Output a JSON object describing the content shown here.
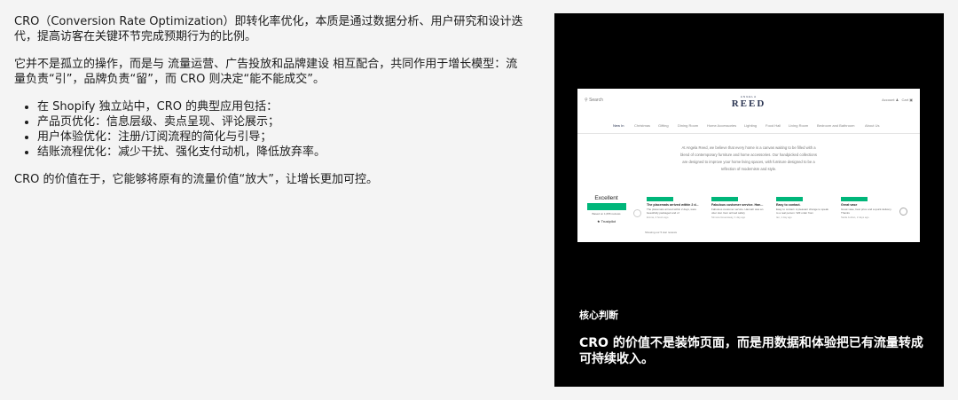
{
  "left": {
    "p1": "CRO（Conversion Rate Optimization）即转化率优化，本质是通过数据分析、用户研究和设计迭代，提高访客在关键环节完成预期行为的比例。",
    "p2": "它并不是孤立的操作，而是与 流量运营、广告投放和品牌建设 相互配合，共同作用于增长模型：流量负责“引”，品牌负责“留”，而 CRO 则决定“能不能成交”。",
    "bullets": [
      "在 Shopify 独立站中，CRO 的典型应用包括：",
      "产品页优化：信息层级、卖点呈现、评论展示；",
      "用户体验优化：注册/订阅流程的简化与引导；",
      "结账流程优化：减少干扰、强化支付动机，降低放弃率。"
    ],
    "p3": "CRO 的价值在于，它能够将原有的流量价值“放大”，让增长更加可控。"
  },
  "panel": {
    "label": "核心判断",
    "message": "CRO 的价值不是装饰页面，而是用数据和体验把已有流量转成可持续收入。"
  },
  "site": {
    "search": "Search",
    "logo_small": "ANGELA",
    "logo": "REED",
    "account": "Account",
    "cart": "Cart",
    "nav": [
      "New In",
      "Christmas",
      "Gifting",
      "Dining Room",
      "Home Accessories",
      "Lighting",
      "Food Hall",
      "Living Room",
      "Bedroom and Bathroom",
      "About Us"
    ],
    "about_lines": [
      "At Angela Reed, we believe that every home is a canvas waiting to be filled with a",
      "blend of contemporary furniture and home accessories. Our handpicked collections",
      "are designed to improve your home living spaces, with furniture designed to be a",
      "reflection of modernism and style."
    ],
    "trustpilot": {
      "rating": "Excellent",
      "based": "Based on 1,055 reviews",
      "brand": "Trustpilot"
    },
    "reviews": [
      {
        "title": "The placemats arrived within 2 d...",
        "body": "The placemats arrived within 2 days, were beautifully packaged and of",
        "meta": "Emma, 2 hours ago"
      },
      {
        "title": "Fabulous customer service. Han...",
        "body": "Fabulous customer service. Hannah was an utter star. Item arrived safely",
        "meta": "Simona Greenaway, 1 day ago"
      },
      {
        "title": "Easy to contact.",
        "body": "Easy to contact. A pleasant change to speak to a real person. Will order from",
        "meta": "Ian, 1 day ago"
      },
      {
        "title": "Great vase",
        "body": "Great vase, best price and a quick delivery. Thanks",
        "meta": "Stella Jordan, 2 days ago"
      }
    ],
    "showing": "Showing our 5 star reviews"
  }
}
